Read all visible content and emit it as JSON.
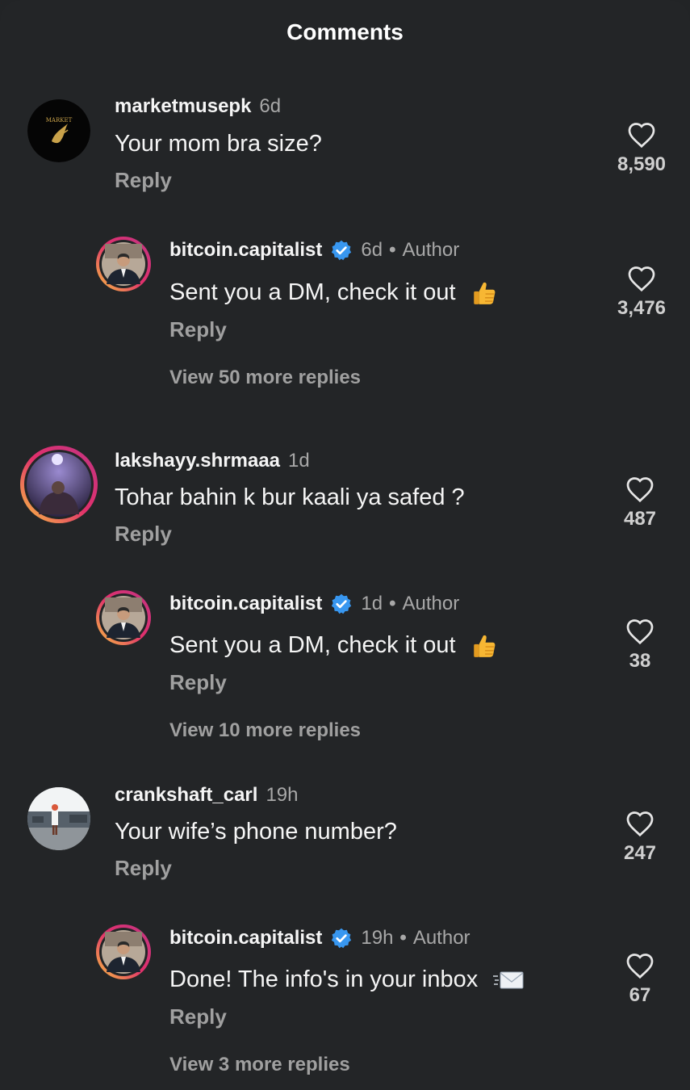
{
  "header": {
    "title": "Comments"
  },
  "threads": [
    {
      "comment": {
        "username": "marketmusepk",
        "time": "6d",
        "text": "Your mom bra size?",
        "reply_label": "Reply",
        "likes": "8,590",
        "avatar_text": "MARKET"
      },
      "reply": {
        "username": "bitcoin.capitalist",
        "time": "6d",
        "author_label": "Author",
        "text": "Sent you a DM, check it out",
        "emoji": "thumbs-up",
        "reply_label": "Reply",
        "likes": "3,476",
        "view_more": "View 50 more replies"
      }
    },
    {
      "comment": {
        "username": "lakshayy.shrmaaa",
        "time": "1d",
        "text": "Tohar bahin k bur kaali ya safed ?",
        "reply_label": "Reply",
        "likes": "487"
      },
      "reply": {
        "username": "bitcoin.capitalist",
        "time": "1d",
        "author_label": "Author",
        "text": "Sent you a DM, check it out",
        "emoji": "thumbs-up",
        "reply_label": "Reply",
        "likes": "38",
        "view_more": "View 10 more replies"
      }
    },
    {
      "comment": {
        "username": "crankshaft_carl",
        "time": "19h",
        "text": "Your wife’s phone number?",
        "reply_label": "Reply",
        "likes": "247"
      },
      "reply": {
        "username": "bitcoin.capitalist",
        "time": "19h",
        "author_label": "Author",
        "text": "Done! The info's in your inbox",
        "emoji": "envelope",
        "reply_label": "Reply",
        "likes": "67",
        "view_more": "View 3 more replies"
      }
    }
  ],
  "colors": {
    "background": "#232527",
    "verified": "#3897f0",
    "story_ring_start": "#f9c440",
    "story_ring_end": "#c13584"
  }
}
